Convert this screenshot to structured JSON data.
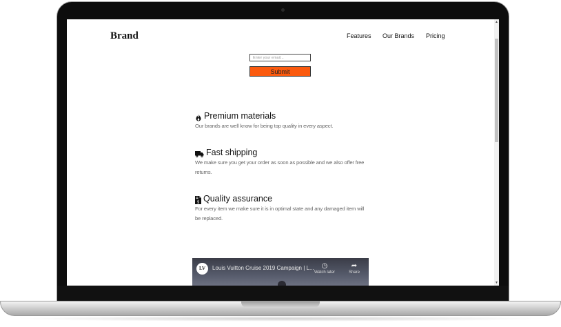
{
  "site": {
    "brand": "Brand"
  },
  "nav": {
    "items": [
      "Features",
      "Our Brands",
      "Pricing"
    ]
  },
  "signup": {
    "email_placeholder": "Enter your email...",
    "submit_label": "Submit"
  },
  "features": [
    {
      "icon": "fire-icon",
      "title": "Premium materials",
      "desc": "Our brands are well know for being top quality in every aspect."
    },
    {
      "icon": "truck-icon",
      "title": "Fast shipping",
      "desc": "We make sure you get your order as soon as possible and we also offer free returns."
    },
    {
      "icon": "file-invoice-icon",
      "title": "Quality assurance",
      "desc": "For every item we make sure it is in optimal state and any damaged item will be replaced."
    }
  ],
  "video": {
    "title": "Louis Vuitton Cruise 2019 Campaign | L...",
    "logo": "LV",
    "watch_later_label": "Watch later",
    "share_label": "Share"
  },
  "colors": {
    "accent": "#fb5a0e"
  }
}
